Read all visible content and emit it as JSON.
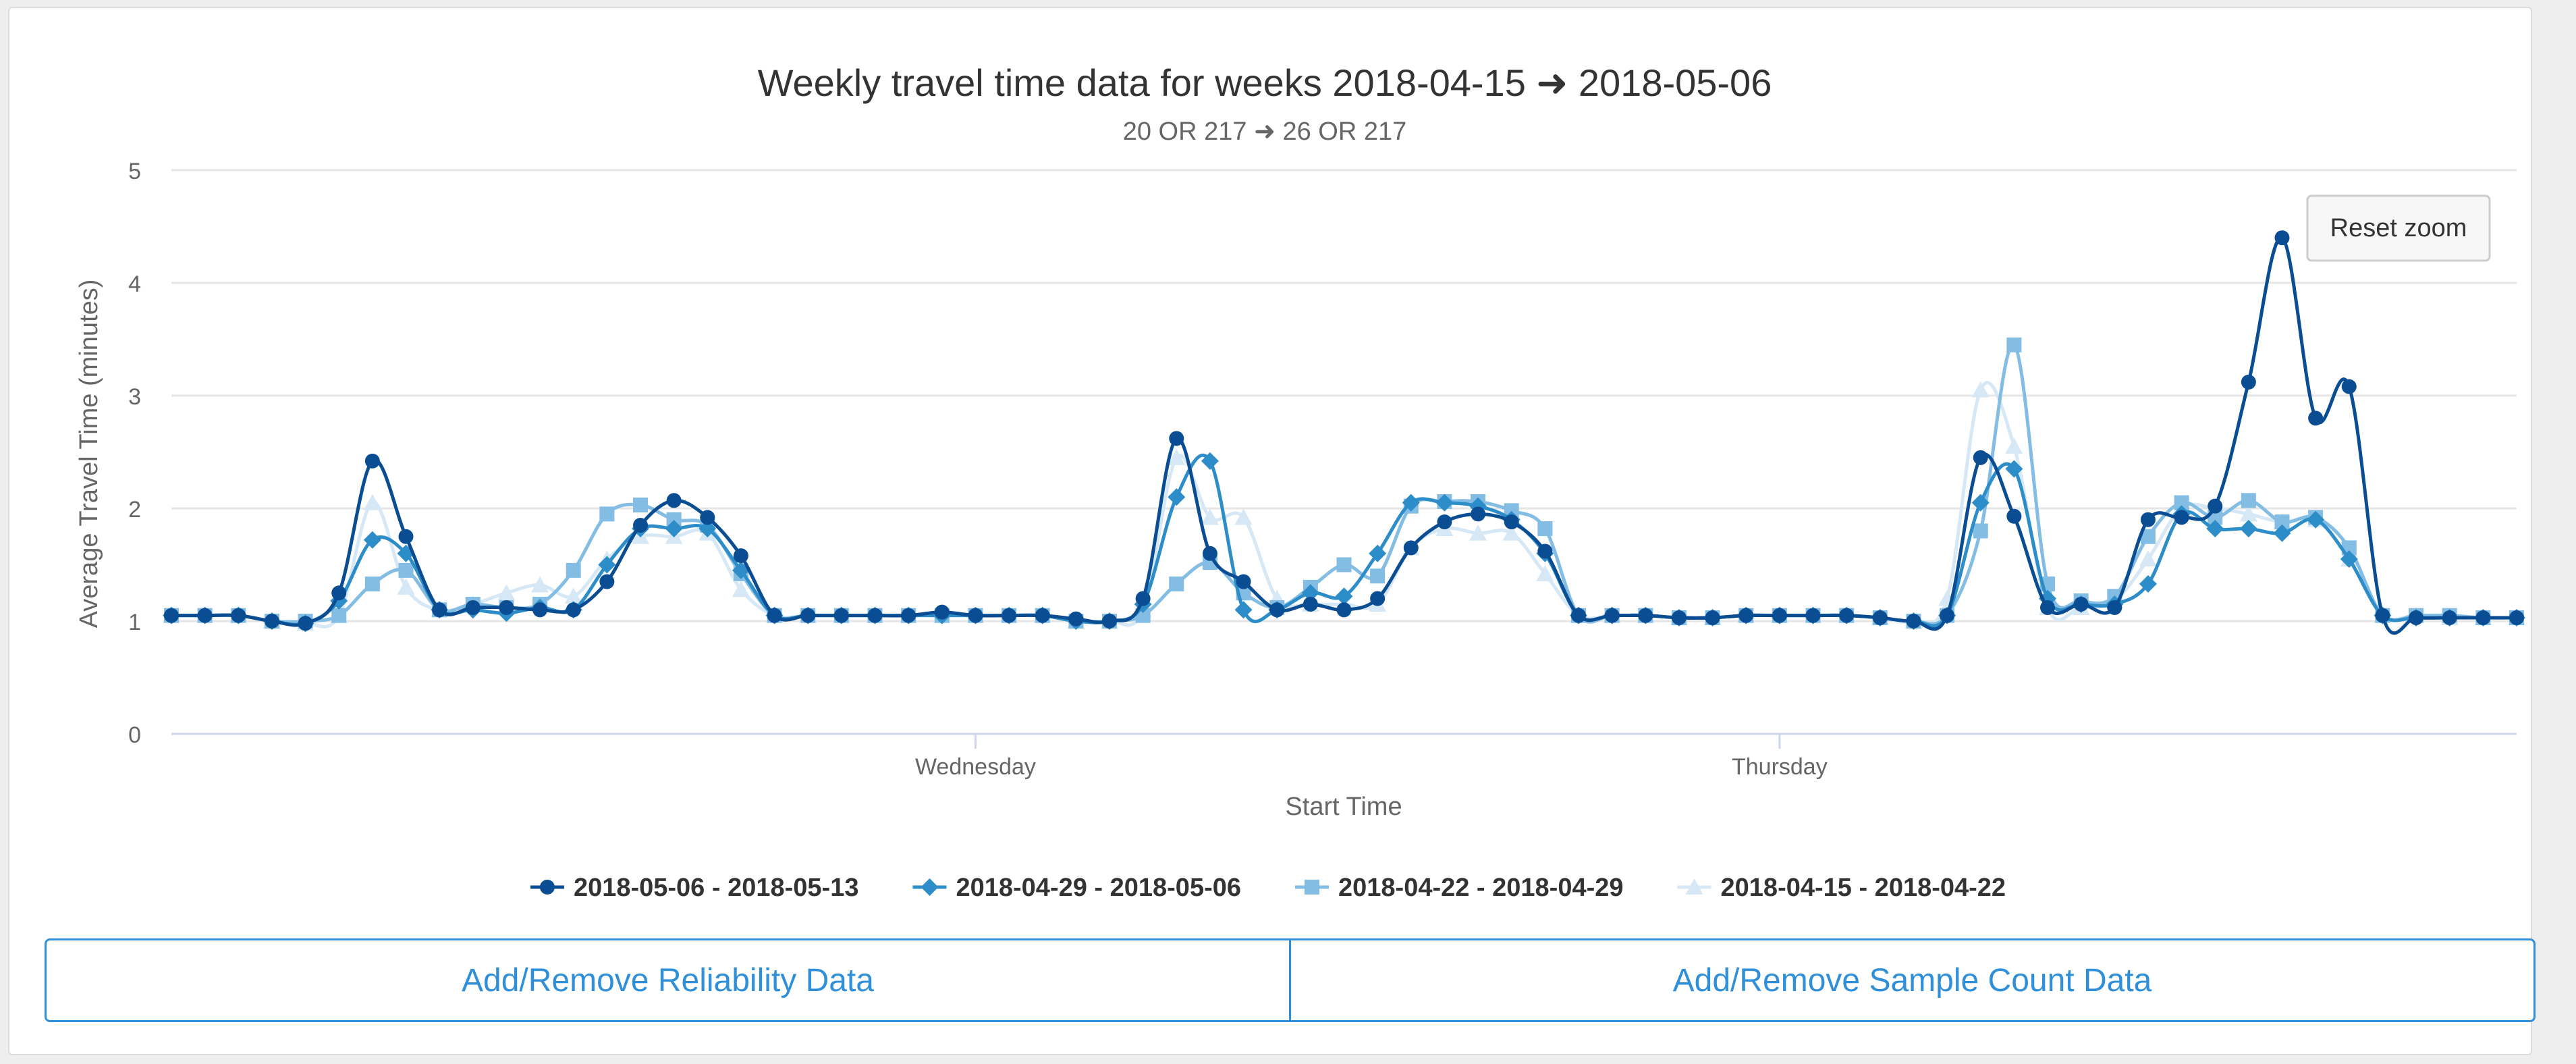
{
  "chart_data": {
    "type": "line",
    "title": "Weekly travel time data for weeks 2018-04-15 ➜ 2018-05-06",
    "subtitle": "20 OR 217 ➜ 26 OR 217",
    "xlabel": "Start Time",
    "ylabel": "Average Travel Time (minutes)",
    "ylim": [
      0,
      5
    ],
    "yticks": [
      0,
      1,
      2,
      3,
      4,
      5
    ],
    "xlim": [
      0,
      70
    ],
    "xticks": [
      {
        "x": 24,
        "label": "Wednesday"
      },
      {
        "x": 48,
        "label": "Thursday"
      }
    ],
    "grid": true,
    "legend_position": "bottom",
    "reset_zoom_label": "Reset zoom",
    "series": [
      {
        "name": "2018-05-06 - 2018-05-13",
        "color": "#0b4d92",
        "marker": "circle",
        "values": [
          1.05,
          1.05,
          1.05,
          1.0,
          0.98,
          1.25,
          2.42,
          1.75,
          1.1,
          1.12,
          1.12,
          1.1,
          1.1,
          1.35,
          1.85,
          2.07,
          1.92,
          1.58,
          1.05,
          1.05,
          1.05,
          1.05,
          1.05,
          1.08,
          1.05,
          1.05,
          1.05,
          1.02,
          1.0,
          1.2,
          2.62,
          1.6,
          1.35,
          1.1,
          1.15,
          1.1,
          1.2,
          1.65,
          1.88,
          1.95,
          1.88,
          1.62,
          1.05,
          1.05,
          1.05,
          1.03,
          1.03,
          1.05,
          1.05,
          1.05,
          1.05,
          1.03,
          1.0,
          1.05,
          2.45,
          1.93,
          1.12,
          1.15,
          1.12,
          1.9,
          1.92,
          2.02,
          3.12,
          4.4,
          2.8,
          3.08,
          1.05,
          1.03,
          1.03,
          1.03,
          1.03
        ]
      },
      {
        "name": "2018-04-29 - 2018-05-06",
        "color": "#2d8dc9",
        "marker": "diamond",
        "values": [
          1.05,
          1.05,
          1.05,
          1.0,
          0.98,
          1.18,
          1.72,
          1.6,
          1.1,
          1.1,
          1.07,
          1.12,
          1.1,
          1.5,
          1.82,
          1.82,
          1.82,
          1.45,
          1.05,
          1.05,
          1.05,
          1.05,
          1.05,
          1.05,
          1.05,
          1.05,
          1.05,
          1.0,
          1.0,
          1.15,
          2.1,
          2.42,
          1.1,
          1.1,
          1.25,
          1.22,
          1.6,
          2.05,
          2.05,
          2.02,
          1.9,
          1.6,
          1.05,
          1.05,
          1.05,
          1.03,
          1.03,
          1.05,
          1.05,
          1.05,
          1.05,
          1.03,
          1.0,
          1.05,
          2.05,
          2.35,
          1.2,
          1.15,
          1.15,
          1.33,
          1.95,
          1.82,
          1.82,
          1.78,
          1.9,
          1.55,
          1.05,
          1.03,
          1.03,
          1.03,
          1.03
        ]
      },
      {
        "name": "2018-04-22 - 2018-04-29",
        "color": "#84bde3",
        "marker": "square",
        "values": [
          1.05,
          1.05,
          1.05,
          1.0,
          1.0,
          1.05,
          1.33,
          1.45,
          1.1,
          1.15,
          1.12,
          1.15,
          1.45,
          1.95,
          2.03,
          1.9,
          1.85,
          1.42,
          1.05,
          1.05,
          1.05,
          1.05,
          1.05,
          1.05,
          1.05,
          1.05,
          1.05,
          1.0,
          1.0,
          1.05,
          1.33,
          1.52,
          1.25,
          1.12,
          1.3,
          1.5,
          1.4,
          2.02,
          2.06,
          2.06,
          1.98,
          1.82,
          1.05,
          1.05,
          1.05,
          1.03,
          1.03,
          1.05,
          1.05,
          1.05,
          1.05,
          1.03,
          1.0,
          1.05,
          1.8,
          3.45,
          1.33,
          1.18,
          1.22,
          1.75,
          2.05,
          1.92,
          2.07,
          1.88,
          1.92,
          1.65,
          1.05,
          1.05,
          1.05,
          1.03,
          1.03
        ]
      },
      {
        "name": "2018-04-15 - 2018-04-22",
        "color": "#d6e8f6",
        "marker": "triangle",
        "values": [
          1.05,
          1.05,
          1.05,
          1.0,
          0.98,
          1.05,
          2.05,
          1.3,
          1.1,
          1.15,
          1.25,
          1.32,
          1.22,
          1.55,
          1.75,
          1.75,
          1.78,
          1.28,
          1.05,
          1.05,
          1.05,
          1.05,
          1.05,
          1.05,
          1.05,
          1.05,
          1.05,
          1.0,
          1.0,
          1.1,
          2.45,
          1.92,
          1.92,
          1.2,
          1.15,
          1.15,
          1.15,
          1.65,
          1.82,
          1.78,
          1.78,
          1.42,
          1.05,
          1.05,
          1.05,
          1.03,
          1.03,
          1.05,
          1.05,
          1.05,
          1.05,
          1.03,
          1.0,
          1.2,
          3.05,
          2.55,
          1.12,
          1.12,
          1.18,
          1.55,
          2.0,
          2.0,
          1.95,
          1.88,
          1.9,
          1.55,
          1.05,
          1.05,
          1.03,
          1.03,
          1.03
        ]
      }
    ]
  },
  "buttons": {
    "reliability_label": "Add/Remove Reliability Data",
    "sample_count_label": "Add/Remove Sample Count Data"
  }
}
